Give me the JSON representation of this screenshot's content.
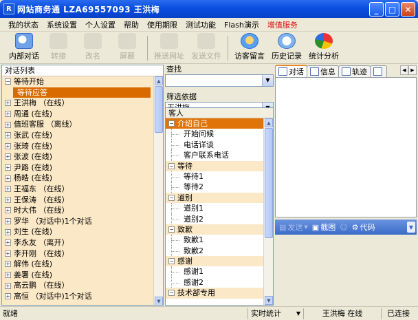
{
  "window": {
    "title": "网站商务通   LZA69557093  王洪梅",
    "app_icon_letter": "R"
  },
  "menu": [
    "我的状态",
    "系统设置",
    "个人设置",
    "帮助",
    "使用期限",
    "测试功能",
    "Flash演示",
    "增值服务"
  ],
  "toolbar": {
    "buttons": [
      {
        "label": "内部对话",
        "icon": "chat-bubble-icon",
        "enabled": true
      },
      {
        "label": "转接",
        "icon": "transfer-icon",
        "enabled": false
      },
      {
        "label": "改名",
        "icon": "rename-icon",
        "enabled": false
      },
      {
        "label": "屏蔽",
        "icon": "block-icon",
        "enabled": false
      },
      {
        "label": "推送网址",
        "icon": "push-url-icon",
        "enabled": false
      },
      {
        "label": "发送文件",
        "icon": "send-file-icon",
        "enabled": false
      },
      {
        "label": "访客留言",
        "icon": "visitor-message-icon",
        "enabled": true
      },
      {
        "label": "历史记录",
        "icon": "history-icon",
        "enabled": true
      },
      {
        "label": "统计分析",
        "icon": "pie-chart-icon",
        "enabled": true
      }
    ]
  },
  "left_panel": {
    "header": "对话列表",
    "rows": [
      {
        "expander": "−",
        "text": "等待开始"
      },
      {
        "expander": "",
        "text": "等待应答",
        "selected": true
      },
      {
        "expander": "+",
        "text": "王洪梅 （在线）"
      },
      {
        "expander": "+",
        "text": "周通  (在线)"
      },
      {
        "expander": "+",
        "text": "值班客服 （离线）"
      },
      {
        "expander": "+",
        "text": "张武  (在线)"
      },
      {
        "expander": "+",
        "text": "张琦  (在线)"
      },
      {
        "expander": "+",
        "text": "张波  (在线)"
      },
      {
        "expander": "+",
        "text": "尹路  (在线)"
      },
      {
        "expander": "+",
        "text": "杨皓  (在线)"
      },
      {
        "expander": "+",
        "text": "王福东 （在线）"
      },
      {
        "expander": "+",
        "text": "王保涛 （在线）"
      },
      {
        "expander": "+",
        "text": "时大伟 （在线）"
      },
      {
        "expander": "+",
        "text": "罗华 （对话中)1个对话"
      },
      {
        "expander": "+",
        "text": "刘生  (在线)"
      },
      {
        "expander": "+",
        "text": "李永友 （离开）"
      },
      {
        "expander": "+",
        "text": "李开刚 （在线）"
      },
      {
        "expander": "+",
        "text": "解伟  (在线)"
      },
      {
        "expander": "+",
        "text": "姜署  (在线)"
      },
      {
        "expander": "+",
        "text": "高云鹏 （在线）"
      },
      {
        "expander": "+",
        "text": "高恒 （对话中)1个对话"
      }
    ]
  },
  "mid_panel": {
    "search_label": "查找",
    "search_value": "",
    "filter_label": "筛选依据",
    "filter_value": "王洪梅",
    "tree_header": "客人",
    "groups": [
      {
        "name": "介绍自己",
        "active": true,
        "items": [
          "开始问候",
          "电话详谈",
          "客户联系电话"
        ]
      },
      {
        "name": "等待",
        "items": [
          "等待1",
          "等待2"
        ]
      },
      {
        "name": "道别",
        "items": [
          "道别1",
          "道别2"
        ]
      },
      {
        "name": "致歉",
        "items": [
          "致歉1",
          "致歉2"
        ]
      },
      {
        "name": "感谢",
        "items": [
          "感谢1",
          "感谢2"
        ]
      },
      {
        "name": "技术部专用",
        "items": []
      }
    ]
  },
  "right_panel": {
    "tabs": [
      "对话",
      "信息",
      "轨迹",
      ""
    ],
    "send_bar": {
      "send": "发送",
      "screenshot": "截图",
      "code": "代码"
    }
  },
  "status": {
    "ready": "就绪",
    "realtime": "实时统计",
    "user": "王洪梅 在线",
    "connection": "已连接"
  },
  "colors": {
    "title_blue": "#0a4ee0",
    "selection_orange": "#d86a00",
    "list_bg": "#fbe8c6",
    "menu_highlight": "#e01010"
  }
}
